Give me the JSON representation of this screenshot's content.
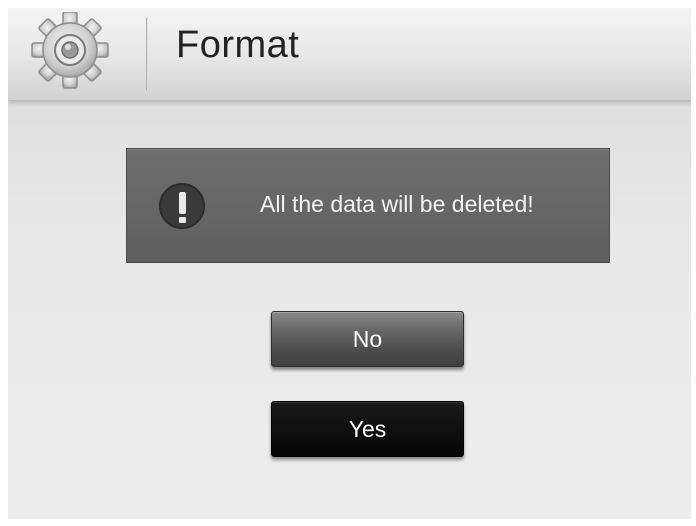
{
  "header": {
    "title": "Format",
    "icon": "gear-icon"
  },
  "alert": {
    "icon": "exclamation-icon",
    "message": "All the data will be deleted!"
  },
  "buttons": {
    "no_label": "No",
    "yes_label": "Yes",
    "selected": "yes"
  },
  "colors": {
    "alert_background": "#666666",
    "selected_button": "#000000",
    "unselected_button": "#555555"
  }
}
